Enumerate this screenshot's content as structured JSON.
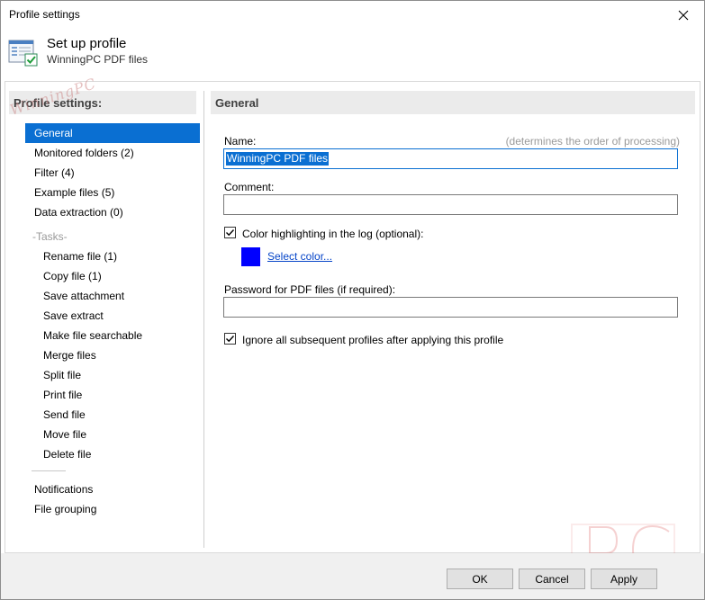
{
  "window": {
    "title": "Profile settings"
  },
  "header": {
    "title": "Set up profile",
    "subtitle": "WinningPC PDF files"
  },
  "sidebar": {
    "heading": "Profile settings:",
    "items": [
      {
        "label": "General",
        "selected": true
      },
      {
        "label": "Monitored folders (2)"
      },
      {
        "label": "Filter (4)"
      },
      {
        "label": "Example files (5)"
      },
      {
        "label": "Data extraction (0)"
      }
    ],
    "tasks_heading": "-Tasks-",
    "tasks": [
      {
        "label": "Rename file (1)"
      },
      {
        "label": "Copy file (1)"
      },
      {
        "label": "Save attachment"
      },
      {
        "label": "Save extract"
      },
      {
        "label": "Make file searchable"
      },
      {
        "label": "Merge files"
      },
      {
        "label": "Split file"
      },
      {
        "label": "Print file"
      },
      {
        "label": "Send file"
      },
      {
        "label": "Move file"
      },
      {
        "label": "Delete file"
      }
    ],
    "bottom_items": [
      {
        "label": "Notifications"
      },
      {
        "label": "File grouping"
      }
    ]
  },
  "main": {
    "heading": "General",
    "name_label": "Name:",
    "name_hint": "(determines the order of processing)",
    "name_value": "WinningPC PDF files",
    "comment_label": "Comment:",
    "comment_value": "",
    "color_checkbox_label": "Color highlighting in the log (optional):",
    "color_checked": true,
    "color_value": "#0000ff",
    "select_color_link": "Select color...",
    "password_label": "Password for PDF files (if required):",
    "password_value": "",
    "ignore_checkbox_label": "Ignore all subsequent profiles after applying this profile",
    "ignore_checked": true
  },
  "footer": {
    "ok_label": "OK",
    "cancel_label": "Cancel",
    "apply_label": "Apply"
  },
  "icons": {
    "close": "close-icon",
    "profile": "profile-settings-icon",
    "check": "checkmark-icon"
  }
}
